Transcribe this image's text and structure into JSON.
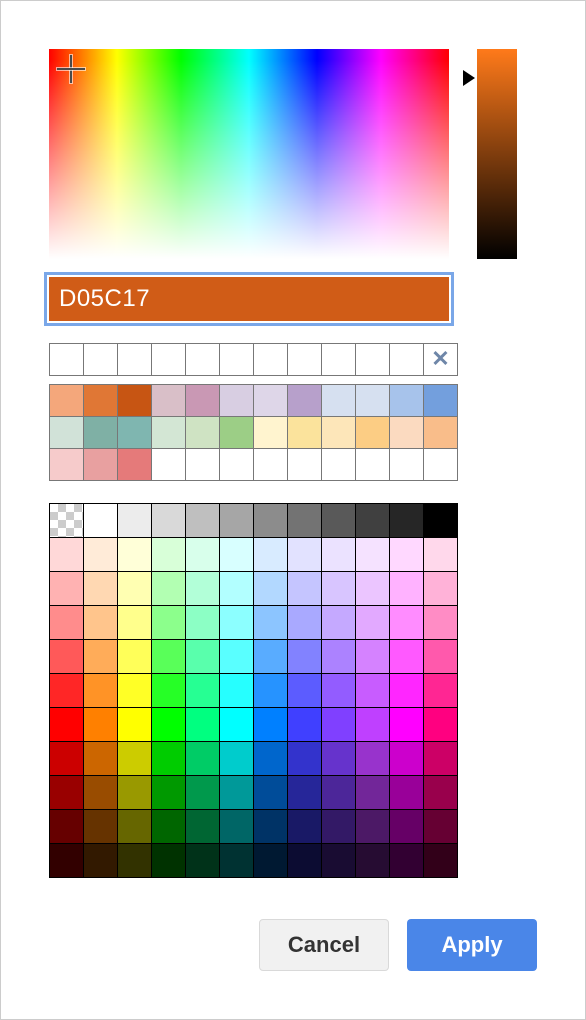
{
  "hex_value": "D05C17",
  "selected_color": "#D05C17",
  "brightness_gradient_top": "#ff7a1a",
  "brightness_arrow_pct": 14,
  "custom_slots": 11,
  "recent_colors": [
    [
      "#f4a77b",
      "#e07735",
      "#c75513",
      "#d9bfc8",
      "#c998b4",
      "#d8cee2",
      "#ded6e8",
      "#b7a0cb",
      "#d6e0f0",
      "#d6e0f0",
      "#a7c3eb",
      "#739fdd"
    ],
    [
      "#d1e2d8",
      "#7fb0a5",
      "#7fb6b0",
      "#d3e6d4",
      "#cfe3c3",
      "#9cce86",
      "#fff4cf",
      "#fbe39c",
      "#fde6b9",
      "#fccd84",
      "#fbdac0",
      "#f9bd8a"
    ],
    [
      "#f6cbcb",
      "#e8a0a0",
      "#e57a7a",
      "#ffffff",
      "#ffffff",
      "#ffffff",
      "#ffffff",
      "#ffffff",
      "#ffffff",
      "#ffffff",
      "#ffffff",
      "#ffffff"
    ]
  ],
  "palette": {
    "gray_row": [
      "transparent",
      "#ffffff",
      "#ececec",
      "#d9d9d9",
      "#bfbfbf",
      "#a6a6a6",
      "#8c8c8c",
      "#737373",
      "#595959",
      "#404040",
      "#262626",
      "#000000"
    ],
    "hues": [
      "#ff0000",
      "#ff8000",
      "#ffff00",
      "#00ff00",
      "#00ff80",
      "#00ffff",
      "#0080ff",
      "#4040ff",
      "#8040ff",
      "#bf40ff",
      "#ff00ff",
      "#ff0080"
    ],
    "tints": [
      0.85,
      0.7,
      0.55,
      0.35,
      0.15,
      0.0
    ],
    "shades": [
      0.2,
      0.4,
      0.6,
      0.8
    ]
  },
  "buttons": {
    "cancel": "Cancel",
    "apply": "Apply"
  }
}
